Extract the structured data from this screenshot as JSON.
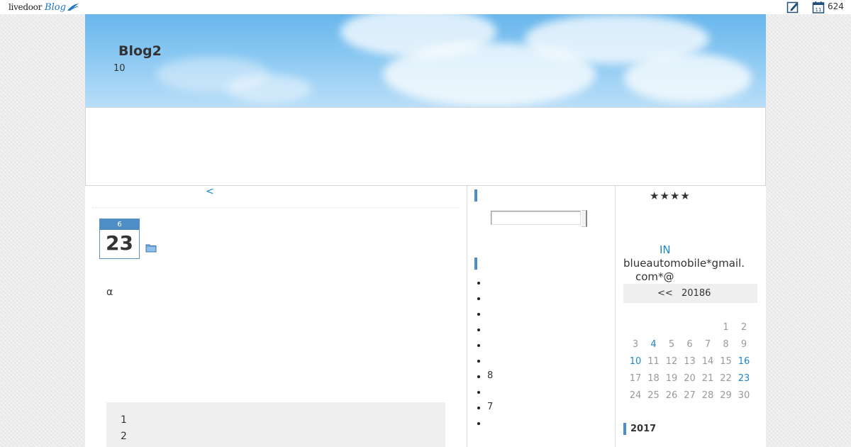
{
  "topbar": {
    "logo_text": "livedoor",
    "logo_blog": "Blog",
    "access_count": "624",
    "icons": [
      "edit-icon",
      "calendar-icon"
    ],
    "calendar_icon_number": "11"
  },
  "header": {
    "title": "Blog2",
    "subtitle": "10"
  },
  "main": {
    "prev_link": "<",
    "post": {
      "month": "6",
      "day": "23",
      "body_text": "α",
      "box_lines": [
        "1",
        "2"
      ]
    }
  },
  "middle": {
    "list_items": [
      "",
      "",
      "",
      "",
      "",
      "",
      "8",
      "",
      "7",
      ""
    ]
  },
  "right": {
    "stars": "★★★★",
    "in_link": "IN",
    "email_line1": "blueautomobile*gmail.",
    "email_line2": "com*@",
    "calendar": {
      "prev": "<<",
      "month_label": "20186",
      "rows": [
        [
          "",
          "",
          "",
          "",
          "",
          "1",
          "2"
        ],
        [
          "3",
          "4",
          "5",
          "6",
          "7",
          "8",
          "9"
        ],
        [
          "10",
          "11",
          "12",
          "13",
          "14",
          "15",
          "16"
        ],
        [
          "17",
          "18",
          "19",
          "20",
          "21",
          "22",
          "23"
        ],
        [
          "24",
          "25",
          "26",
          "27",
          "28",
          "29",
          "30"
        ]
      ],
      "linked_days": [
        "4",
        "10",
        "16",
        "23"
      ]
    },
    "archive_year": "2017"
  },
  "colors": {
    "accent": "#4f8dc6",
    "link": "#1d86c8",
    "sky_top": "#68b6ec",
    "sky_bottom": "#b9def8"
  }
}
